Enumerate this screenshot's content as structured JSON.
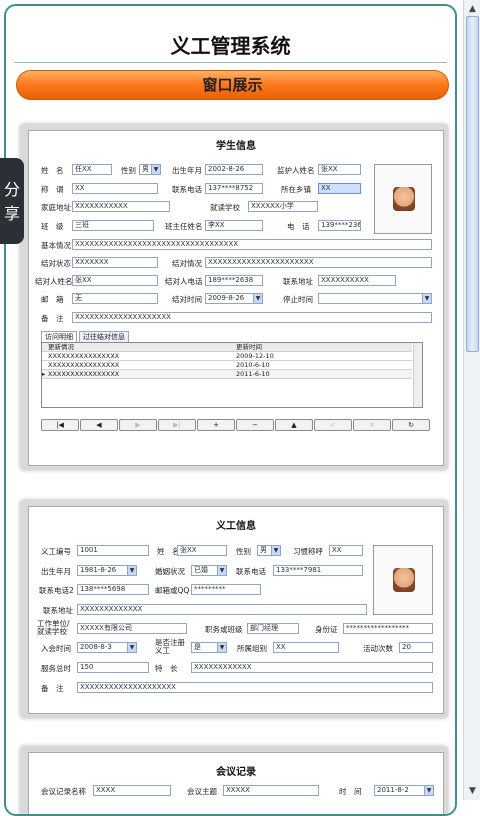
{
  "app": {
    "title": "义工管理系统",
    "banner": "窗口展示",
    "share": "分享"
  },
  "student": {
    "title": "学生信息",
    "fields": {
      "name_label": "姓　名",
      "name": "任XX",
      "gender_label": "性别",
      "gender": "男",
      "birth_label": "出生年月",
      "birth": "2002-8-26",
      "guardian_label": "监护人姓名",
      "guardian": "张XX",
      "title_label": "称　谓",
      "title_value": "XX",
      "phone_label": "联系电话",
      "phone": "137****8752",
      "town_label": "所在乡镇",
      "town": "XX",
      "home_label": "家庭地址",
      "home": "XXXXXXXXXXX",
      "school_label": "就读学校",
      "school": "XXXXXX小学",
      "class_label": "班　级",
      "class_value": "三班",
      "teacher_label": "班主任姓名",
      "teacher": "李XX",
      "tel_label": "电　话",
      "tel": "139****2369",
      "basic_label": "基本情况",
      "basic": "XXXXXXXXXXXXXXXXXXXXXXXXXXXXXXXXXX",
      "pair_status_label": "结对状态",
      "pair_status": "XXXXXXX",
      "pair_info_label": "结对情况",
      "pair_info": "XXXXXXXXXXXXXXXXXXXXXX",
      "pair_person_label": "结对人姓名",
      "pair_person": "张XX",
      "pair_phone_label": "结对人电话",
      "pair_phone": "189****2638",
      "address_label": "联系地址",
      "address": "XXXXXXXXXX",
      "post_label": "邮　箱",
      "post": "无",
      "pair_time_label": "结对时间",
      "pair_time": "2009-8-26",
      "stop_label": "停止时间",
      "stop": "",
      "note_label": "备　注",
      "note": "XXXXXXXXXXXXXXXXXXXX"
    },
    "tabs": [
      "访问明细",
      "过往结对信息"
    ],
    "grid": {
      "headers": [
        "更新情况",
        "更新时间"
      ],
      "rows": [
        [
          "XXXXXXXXXXXXXXXX",
          "2009-12-10"
        ],
        [
          "XXXXXXXXXXXXXXXX",
          "2010-6-10"
        ],
        [
          "XXXXXXXXXXXXXXXX",
          "2011-6-10"
        ]
      ]
    },
    "nav": [
      "|◀",
      "◀",
      "▶",
      "▶|",
      "+",
      "−",
      "▲",
      "✓",
      "✕",
      "↻"
    ]
  },
  "volunteer": {
    "title": "义工信息",
    "fields": {
      "id_label": "义工编号",
      "id": "1001",
      "name_label": "姓　名",
      "name": "张XX",
      "gender_label": "性别",
      "gender": "男",
      "habit_label": "习惯称呼",
      "habit": "XX",
      "birth_label": "出生年月",
      "birth": "1981-8-26",
      "marital_label": "婚姻状况",
      "marital": "已婚",
      "phone_label": "联系电话",
      "phone": "133****7981",
      "phone2_label": "联系电话2",
      "phone2": "138****5698",
      "email_label": "邮箱或QQ",
      "email": "*********",
      "address_label": "联系地址",
      "address": "XXXXXXXXXXXXX",
      "work_label": "工作单位/就读学校",
      "work": "XXXXX有限公司",
      "post_label": "职务或班级",
      "post": "部门经理",
      "idcard_label": "身份证",
      "idcard": "******************",
      "join_label": "入会时间",
      "join": "2008-8-3",
      "reg_label": "是否注册义工",
      "reg": "是",
      "group_label": "所属组别",
      "group": "XX",
      "activity_label": "活动次数",
      "activity": "20",
      "hours_label": "服务总时",
      "hours": "150",
      "skill_label": "特　长",
      "skill": "XXXXXXXXXXXX",
      "note_label": "备　注",
      "note": "XXXXXXXXXXXXXXXXXXXX"
    }
  },
  "meeting": {
    "title": "会议记录",
    "fields": {
      "name_label": "会议记录名称",
      "name": "XXXX",
      "topic_label": "会议主题",
      "topic": "XXXXX",
      "time_label": "时　间",
      "time": "2011-8-2"
    }
  }
}
